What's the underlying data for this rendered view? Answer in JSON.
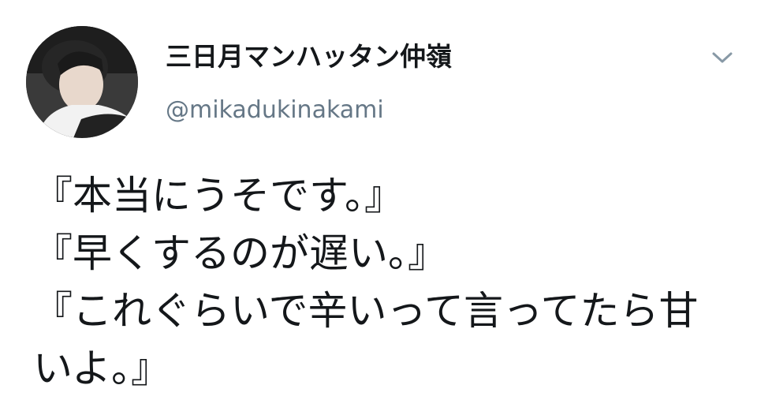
{
  "tweet": {
    "author": {
      "display_name": "三日月マンハッタン仲嶺",
      "handle": "@mikadukinakami",
      "avatar_icon": "profile-photo"
    },
    "menu_icon": "chevron-down-icon",
    "text_lines": [
      "『本当にうそです。』",
      "『早くするのが遅い。』",
      "『これぐらいで辛いって言ってたら甘いよ。』"
    ]
  },
  "colors": {
    "text_primary": "#14171a",
    "text_secondary": "#657786",
    "icon": "#8899a6",
    "background": "#ffffff"
  }
}
